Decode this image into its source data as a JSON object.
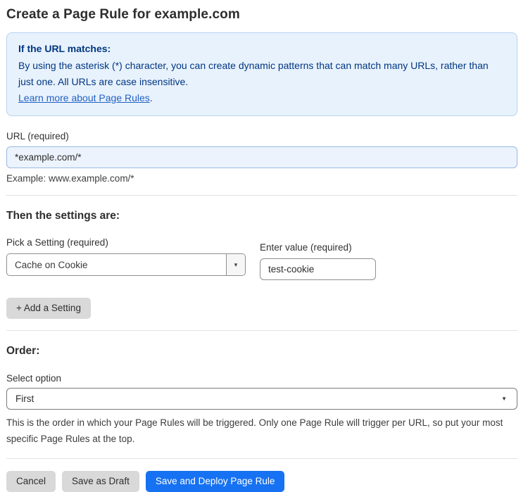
{
  "page": {
    "title": "Create a Page Rule for example.com"
  },
  "info_box": {
    "heading": "If the URL matches:",
    "body": "By using the asterisk (*) character, you can create dynamic patterns that can match many URLs, rather than just one. All URLs are case insensitive.",
    "link_label": "Learn more about Page Rules",
    "link_suffix": "."
  },
  "url_field": {
    "label": "URL (required)",
    "value": "*example.com/*",
    "help": "Example: www.example.com/*"
  },
  "settings_section": {
    "heading": "Then the settings are:",
    "setting_select": {
      "label": "Pick a Setting (required)",
      "selected": "Cache on Cookie",
      "arrow_icon": "▼"
    },
    "value_field": {
      "label": "Enter value (required)",
      "value": "test-cookie"
    },
    "add_setting_label": "+ Add a Setting"
  },
  "order_section": {
    "heading": "Order:",
    "select_label": "Select option",
    "selected": "First",
    "arrow_icon": "▼",
    "help": "This is the order in which your Page Rules will be triggered. Only one Page Rule will trigger per URL, so put your most specific Page Rules at the top."
  },
  "footer": {
    "cancel_label": "Cancel",
    "save_draft_label": "Save as Draft",
    "save_deploy_label": "Save and Deploy Page Rule"
  },
  "colors": {
    "accent_blue": "#1672f2",
    "info_bg": "#e8f2fc",
    "info_border": "#b5d3f0",
    "info_text": "#003682",
    "link_blue": "#2260c4",
    "url_input_bg": "#ecf3fc",
    "url_input_border": "#97b9e4",
    "gray_button_bg": "#d9d9d9"
  }
}
